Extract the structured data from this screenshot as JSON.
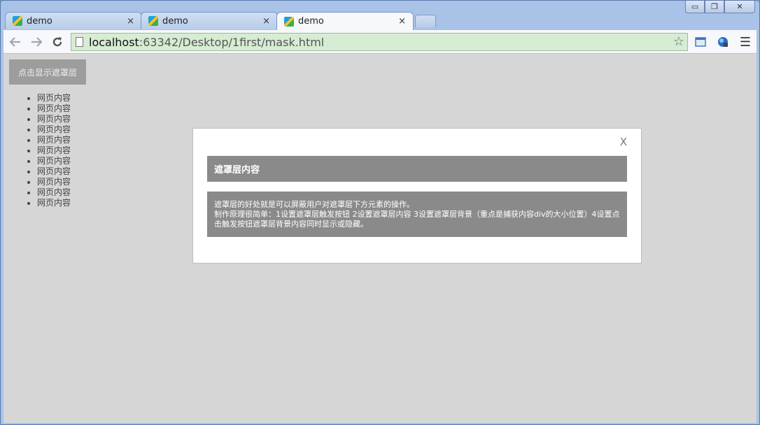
{
  "browser": {
    "tabs": [
      {
        "title": "demo",
        "close": "×",
        "active": false
      },
      {
        "title": "demo",
        "close": "×",
        "active": false
      },
      {
        "title": "demo",
        "close": "×",
        "active": true
      }
    ],
    "address": {
      "host": "localhost",
      "rest": ":63342/Desktop/1first/mask.html"
    },
    "icons": {
      "back": "back-arrow-icon",
      "forward": "forward-arrow-icon",
      "reload": "reload-icon",
      "star": "bookmark-star-icon",
      "menu": "hamburger-menu-icon"
    },
    "caption": {
      "minimize": "▭",
      "restore": "❐",
      "close": "✕"
    }
  },
  "page": {
    "show_button": "点击显示遮罩层",
    "list_items": [
      "网页内容",
      "网页内容",
      "网页内容",
      "网页内容",
      "网页内容",
      "网页内容",
      "网页内容",
      "网页内容",
      "网页内容",
      "网页内容",
      "网页内容"
    ]
  },
  "modal": {
    "close_label": "X",
    "title": "遮罩层内容",
    "body_line1": "遮罩层的好处就是可以屏蔽用户对遮罩层下方元素的操作。",
    "body_line2": "制作原理很简单：1设置遮罩层触发按钮 2设置遮罩层内容 3设置遮罩层背景（重点是捕获内容div的大小位置）4设置点击触发按钮遮罩层背景内容同时显示或隐藏。"
  },
  "colors": {
    "viewport_bg": "#d6d6d6",
    "modal_panel": "#8a8a8a",
    "omnibox_bg": "#d6ecd3"
  }
}
